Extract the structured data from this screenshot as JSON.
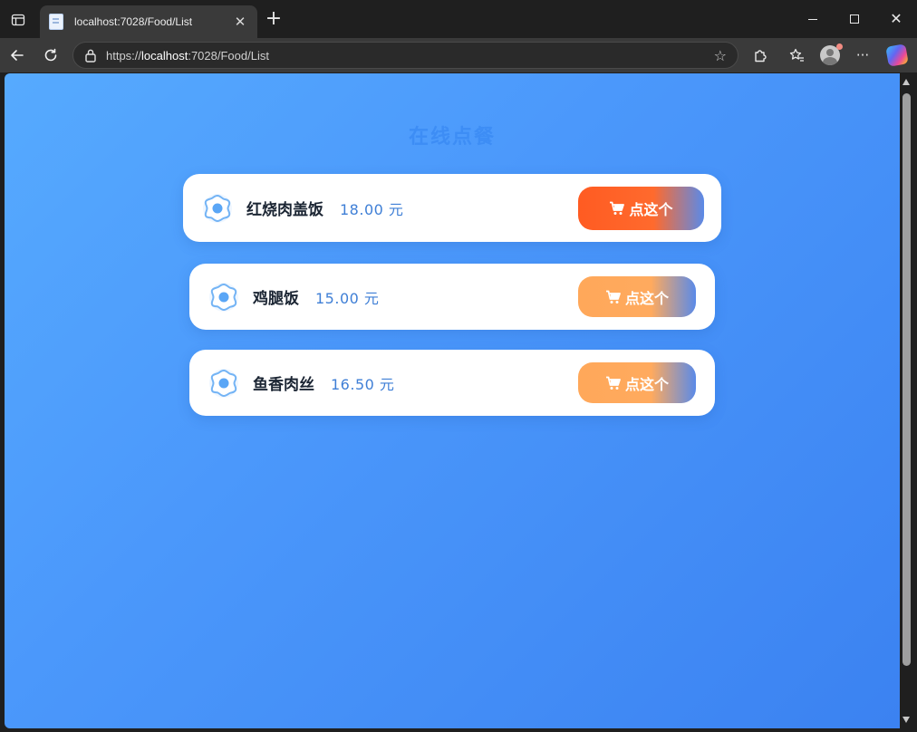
{
  "browser": {
    "tab_title": "localhost:7028/Food/List",
    "tab_close": "✕",
    "new_tab": "+",
    "url_prefix": "https://",
    "url_host": "localhost",
    "url_rest": ":7028/Food/List",
    "more_label": "···"
  },
  "page": {
    "title": "在线点餐",
    "background_colors": [
      "#56aafe",
      "#3b82f1"
    ]
  },
  "foods": [
    {
      "name": "红烧肉盖饭",
      "price": "18.00 元",
      "button": "点这个",
      "state": "hover"
    },
    {
      "name": "鸡腿饭",
      "price": "15.00 元",
      "button": "点这个",
      "state": "normal"
    },
    {
      "name": "鱼香肉丝",
      "price": "16.50 元",
      "button": "点这个",
      "state": "normal"
    }
  ],
  "icons": {
    "food": "food-flower-icon",
    "cart": "cart-icon"
  }
}
